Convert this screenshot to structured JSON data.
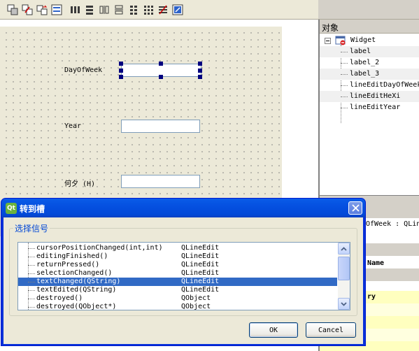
{
  "toolbar": {
    "icons": [
      "edit-widgets-icon",
      "edit-signals-icon",
      "edit-buddies-icon",
      "edit-tab-order-icon",
      "layout-horizontal-icon",
      "layout-vertical-icon",
      "layout-horizontal-splitter-icon",
      "layout-vertical-splitter-icon",
      "layout-form-icon",
      "layout-grid-icon",
      "break-layout-icon",
      "adjust-size-icon"
    ]
  },
  "form": {
    "labels": [
      "DayOfWeek",
      "Year",
      "何夕 (H)"
    ]
  },
  "object_inspector": {
    "header": "对象",
    "root": "Widget",
    "children": [
      "label",
      "label_2",
      "label_3",
      "lineEditDayOfWeek",
      "lineEditHeXi",
      "lineEditYear"
    ]
  },
  "property_editor": {
    "title": "OfWeek : QLin",
    "rows": [
      "Name",
      "ry"
    ]
  },
  "dialog": {
    "title": "转到槽",
    "group_title": "选择信号",
    "signals": [
      {
        "signal": "cursorPositionChanged(int,int)",
        "class": "QLineEdit"
      },
      {
        "signal": "editingFinished()",
        "class": "QLineEdit"
      },
      {
        "signal": "returnPressed()",
        "class": "QLineEdit"
      },
      {
        "signal": "selectionChanged()",
        "class": "QLineEdit"
      },
      {
        "signal": "textChanged(QString)",
        "class": "QLineEdit"
      },
      {
        "signal": "textEdited(QString)",
        "class": "QLineEdit"
      },
      {
        "signal": "destroyed()",
        "class": "QObject"
      },
      {
        "signal": "destroyed(QObject*)",
        "class": "QObject"
      }
    ],
    "selected_index": 4,
    "ok_label": "OK",
    "cancel_label": "Cancel"
  },
  "colors": {
    "selection": "#316ac5",
    "title_bar": "#0550e0",
    "group_title": "#0046d5"
  }
}
